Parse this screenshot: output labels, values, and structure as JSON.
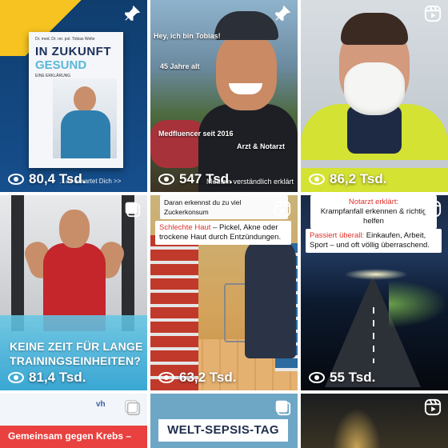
{
  "grid": {
    "tiles": [
      {
        "kind": "post",
        "views": "80,4 Tsd.",
        "book": {
          "author": "Dr. med. Dr. rer. pol. Tobias Welte",
          "title_line1": "IN ZUKUNFT",
          "title_line2": "GESUND",
          "subtitle": "EINE ERKLÄRUNG"
        },
        "blurb": "…as erwartet Dich >>",
        "corner_icon": "pin-icon"
      },
      {
        "kind": "post",
        "views": "547 Tsd.",
        "labels": {
          "hey": "Hey, ich bin Tobias!",
          "age": "45 Jahre alt",
          "medfluencer": "Medfluencer seit 2016",
          "role": "Arzt & Notarzt",
          "tagline": "Medizin verständlich erklärt"
        },
        "corner_icon": "pin-icon"
      },
      {
        "kind": "reel",
        "views": "86,2 Tsd.",
        "corner_icon": "reel-icon"
      },
      {
        "kind": "post",
        "views": "81,4 Tsd.",
        "headline_line1": "KEINE ZEIT FÜR LANGE",
        "headline_line2": "TRAININGSEINHEITEN?",
        "corner_icon": "multi-image-icon"
      },
      {
        "kind": "reel",
        "views": "63,2 Tsd.",
        "overlay_top": "Daran erkennst du zu viel Zuckerkonsum",
        "overlay_title": "Schlechte Haut",
        "overlay_rest": " – Pickel, Akne oder trockene Haut durch Entzündungen.",
        "corner_icon": "reel-icon"
      },
      {
        "kind": "reel",
        "views": "55 Tsd.",
        "overlay_top_title": "Notarzt erklärt:",
        "overlay_top_body": "Krampfanfall erkennen & richtig helfen",
        "overlay_title": "Passiert überall:",
        "overlay_rest": " Einkaufen, Arbeit, Sport – und oft völlig überraschend.",
        "corner_icon": "reel-icon"
      },
      {
        "kind": "post",
        "logo": "vh",
        "banner": "Gemeinsam gegen Krebs –",
        "corner_icon": "multi-image-icon"
      },
      {
        "kind": "post",
        "banner": "WELT-SEPSIS-TAG",
        "corner_icon": "multi-image-icon"
      },
      {
        "kind": "reel",
        "corner_icon": "reel-icon"
      }
    ]
  },
  "colors": {
    "overlay_text": "#ffffff",
    "accent_red": "#e0312a"
  }
}
